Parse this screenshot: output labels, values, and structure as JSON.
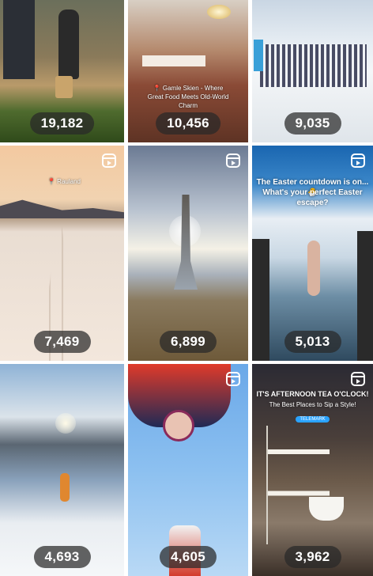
{
  "tiles": [
    {
      "count": "19,182"
    },
    {
      "count": "10,456",
      "caption": "📍 Gamle Skien - Where Great Food Meets Old-World Charm"
    },
    {
      "count": "9,035"
    },
    {
      "count": "7,469",
      "location": "📍 Rauland"
    },
    {
      "count": "6,899"
    },
    {
      "count": "5,013",
      "title_line1": "The Easter countdown is on...🐣",
      "title_line2": "What's your perfect Easter escape?"
    },
    {
      "count": "4,693"
    },
    {
      "count": "4,605"
    },
    {
      "count": "3,962",
      "title_line1": "IT'S AFTERNOON TEA O'CLOCK!",
      "title_line2": "The Best Places to Sip a Style!",
      "tag": "TELEMARK"
    }
  ],
  "icons": {
    "reel": "reels-icon"
  },
  "colors": {
    "badge_bg": "#282828",
    "badge_text": "#ffffff",
    "gap": "#ffffff"
  }
}
